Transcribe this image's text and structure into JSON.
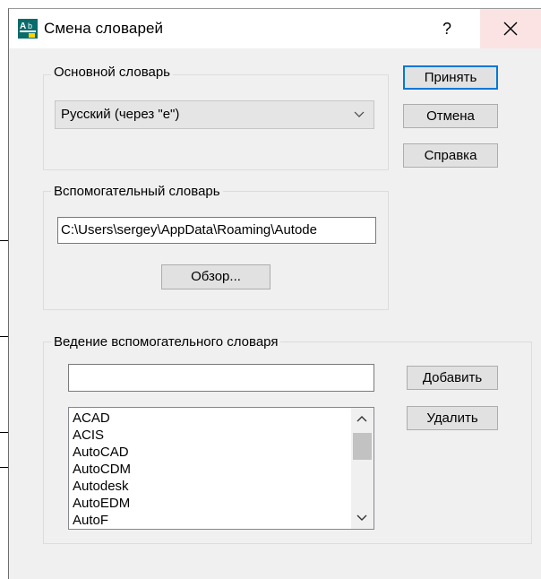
{
  "window": {
    "title": "Смена словарей",
    "help_label": "?",
    "icon": "dictionary-app-icon",
    "close_icon": "close-icon"
  },
  "main_dictionary": {
    "label": "Основной словарь",
    "selected": "Русский (через \"е\")"
  },
  "buttons": {
    "accept": "Принять",
    "cancel": "Отмена",
    "help": "Справка",
    "browse": "Обзор...",
    "add": "Добавить",
    "delete": "Удалить"
  },
  "aux_dictionary": {
    "label": "Вспомогательный словарь",
    "path": "C:\\Users\\sergey\\AppData\\Roaming\\Autode"
  },
  "aux_management": {
    "label": "Ведение вспомогательного словаря",
    "new_word": "",
    "words": [
      "ACAD",
      "ACIS",
      "AutoCAD",
      "AutoCDM",
      "Autodesk",
      "AutoEDM",
      "AutoF"
    ]
  },
  "colors": {
    "default_button_border": "#0078d7",
    "close_button_hover": "#fbe3e4",
    "dialog_background": "#f0f0f0"
  }
}
